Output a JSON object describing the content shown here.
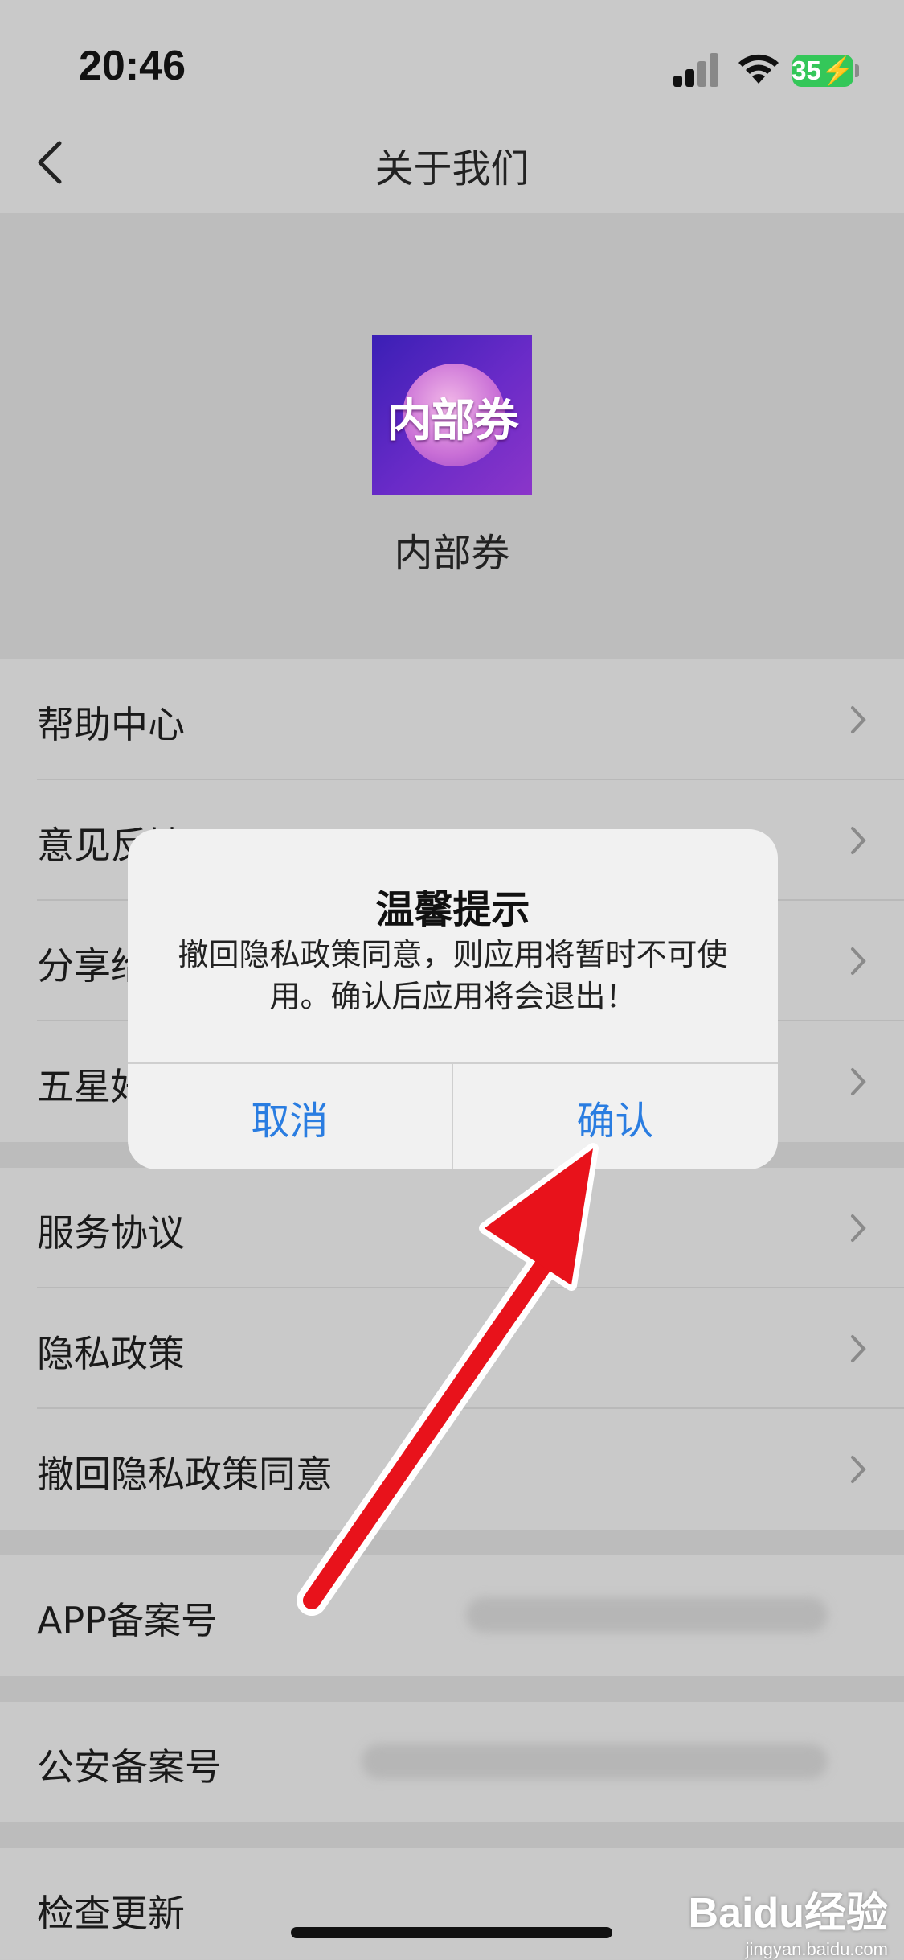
{
  "status_bar": {
    "time": "20:46",
    "battery": "35"
  },
  "nav": {
    "title": "关于我们"
  },
  "app": {
    "icon_text": "内部券",
    "name": "内部券"
  },
  "menu_group1": [
    "帮助中心",
    "意见反馈",
    "分享给好友",
    "五星好评"
  ],
  "menu_group2": [
    "服务协议",
    "隐私政策",
    "撤回隐私政策同意"
  ],
  "info_rows": {
    "app_record": "APP备案号",
    "police_record": "公安备案号"
  },
  "update_row": {
    "label": "检查更新"
  },
  "dialog": {
    "title": "温馨提示",
    "message": "撤回隐私政策同意，则应用将暂时不可使用。确认后应用将会退出！",
    "cancel": "取消",
    "confirm": "确认"
  },
  "watermark": {
    "brand": "Baidu经验",
    "url": "jingyan.baidu.com"
  },
  "colors": {
    "accent": "#2a7de1",
    "annotation_arrow": "#e8121b"
  }
}
